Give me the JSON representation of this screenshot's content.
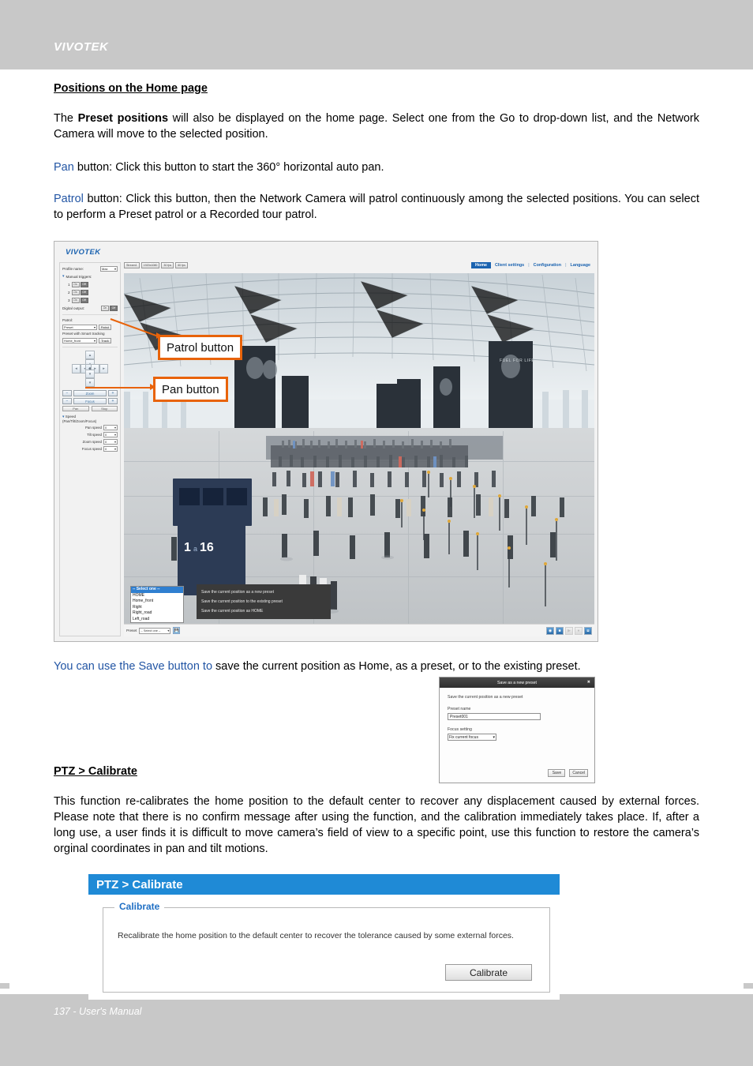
{
  "header": {
    "brand": "VIVOTEK"
  },
  "footer": {
    "page_note": "137 - User's Manual"
  },
  "sections": {
    "positions_heading": "Positions on the Home page",
    "para_preset_lead": "The ",
    "para_preset_bold": "Preset positions",
    "para_preset_rest": " will also be displayed on the home page. Select one from the Go to drop-down list, and the Network Camera will move to the selected position.",
    "pan_label": "Pan",
    "pan_text": " button: Click this button to start the 360° horizontal auto pan.",
    "patrol_label": "Patrol",
    "patrol_text": " button: Click this button, then the Network Camera will patrol continuously among the selected positions. You can select to perform a Preset patrol or a Recorded tour patrol.",
    "save_note_blue": "You can use the Save button to",
    "save_note_rest": "  save the current position as Home, as a preset, or to the existing preset.",
    "calibrate_heading": "PTZ > Calibrate",
    "calibrate_para": "This function re-calibrates the home position to the default center to recover any displacement caused by external forces. Please note that there is no confirm message after using the function, and the calibration immediately takes place. If, after a long use, a user finds it is difficult to move camera’s field of view to a specific point, use this function to restore the camera’s orginal coordinates in pan and tilt motions."
  },
  "camera_ui": {
    "logo": "VIVOTEK",
    "sidebar": {
      "profile_name_label": "Profile name:",
      "profile_name_value": "Max",
      "manual_triggers_label": "Manual triggers:",
      "trigger_rows": [
        {
          "num": "1",
          "on": "On",
          "off": "Off"
        },
        {
          "num": "2",
          "on": "On",
          "off": "Off"
        },
        {
          "num": "3",
          "on": "On",
          "off": "Off"
        }
      ],
      "digital_output_label": "Digital output:",
      "digital_output_on": "On",
      "digital_output_off": "Off",
      "patrol_label": "Patrol:",
      "patrol_select_value": "Preset",
      "patrol_button": "Patrol",
      "smart_tracking_label": "Preset with Smart tracking",
      "smart_tracking_value": "Home_front",
      "track_button": "Track",
      "zoom_label": "Zoom",
      "focus_label": "Focus",
      "pan_button": "Pan",
      "stop_button": "Stop",
      "speed_title": "Speed",
      "speed_subtitle": "(Pan/Tilt/Zoom/Focus)",
      "speed_rows": [
        {
          "label": "Pan speed",
          "value": "0"
        },
        {
          "label": "Tilt speed",
          "value": "0"
        },
        {
          "label": "Zoom speed",
          "value": "0"
        },
        {
          "label": "Focus speed",
          "value": "0"
        }
      ]
    },
    "stream_buttons": [
      "Stream1",
      "1920x1080",
      "30 fps",
      "60 fps"
    ],
    "topnav": [
      {
        "label": "Home",
        "active": true
      },
      {
        "label": "Client settings",
        "active": false
      },
      {
        "label": "Configuration",
        "active": false
      },
      {
        "label": "Language",
        "active": false
      }
    ],
    "preset_list": {
      "selected": "-- Select one --",
      "items": [
        "HOME",
        "Home_front",
        "Right",
        "Right_road",
        "Left_road"
      ]
    },
    "context_menu": [
      "Save the current position as a new preset",
      "Save the current position to the existing preset",
      "Save the current position as HOME"
    ],
    "bottom_bar": {
      "preset_label": "Preset",
      "preset_value": "-- Select one --",
      "save_icon": "save-icon",
      "media_icons": [
        "snapshot-icon",
        "record-icon",
        "volume-icon",
        "mic-icon",
        "fullscreen-icon"
      ]
    },
    "callouts": [
      {
        "text": "Patrol button"
      },
      {
        "text": "Pan button"
      }
    ]
  },
  "preset_dialog": {
    "title": "Save as a new preset",
    "close_icon": "close-icon",
    "description": "Save the current position as a new preset",
    "name_label": "Preset name",
    "name_value": "Preset001",
    "focus_label": "Focus setting",
    "focus_value": "Fix current focus",
    "save_button": "Save",
    "cancel_button": "Cancel"
  },
  "ptz_panel": {
    "header": "PTZ  > Calibrate",
    "legend": "Calibrate",
    "body_text": "Recalibrate the home position to the default center to recover the tolerance caused by some external forces.",
    "button": "Calibrate"
  },
  "colors": {
    "callout_orange": "#e8630a",
    "link_blue": "#2255a4",
    "panel_blue": "#1f8ad6",
    "nav_blue": "#1b63b0"
  }
}
